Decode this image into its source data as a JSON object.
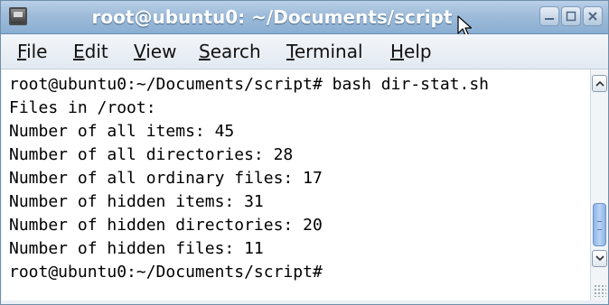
{
  "window": {
    "title": "root@ubuntu0: ~/Documents/script"
  },
  "menu": {
    "file": {
      "mnemonic": "F",
      "rest": "ile"
    },
    "edit": {
      "mnemonic": "E",
      "rest": "dit"
    },
    "view": {
      "mnemonic": "V",
      "rest": "iew"
    },
    "search": {
      "mnemonic": "S",
      "rest": "earch"
    },
    "terminal": {
      "mnemonic": "T",
      "rest": "erminal"
    },
    "help": {
      "mnemonic": "H",
      "rest": "elp"
    }
  },
  "terminal": {
    "lines": [
      "root@ubuntu0:~/Documents/script# bash dir-stat.sh",
      "Files in /root:",
      "Number of all items: 45",
      "Number of all directories: 28",
      "Number of all ordinary files: 17",
      "Number of hidden items: 31",
      "Number of hidden directories: 20",
      "Number of hidden files: 11",
      "root@ubuntu0:~/Documents/script#"
    ]
  },
  "icons": {
    "app": "terminal-icon",
    "cursor": "mouse-pointer-icon",
    "minimize": "minimize-icon",
    "maximize": "maximize-icon",
    "close": "close-icon",
    "scroll_up": "chevron-up-icon",
    "scroll_down": "chevron-down-icon"
  },
  "colors": {
    "titlebar": "#9ebbd9",
    "scroll_thumb": "#8fb4e6"
  }
}
